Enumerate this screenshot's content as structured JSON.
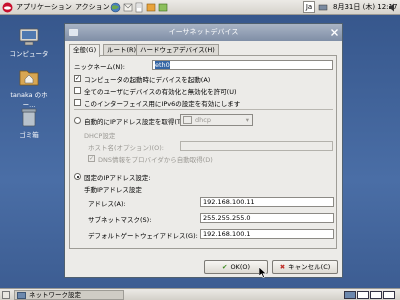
{
  "top_panel": {
    "apps_menu": "アプリケーション",
    "actions_menu": "アクション",
    "ime_indicator": "Ja",
    "clock": "8月31日 (木) 12:17"
  },
  "desktop_icons": [
    {
      "label": "コンピュータ"
    },
    {
      "label": "tanaka のホー..."
    },
    {
      "label": "ゴミ箱"
    }
  ],
  "window": {
    "title": "イーサネットデバイス",
    "tabs": [
      "全般(G)",
      "ルート(R)",
      "ハードウェアデバイス(H)"
    ],
    "nickname_label": "ニックネーム(N):",
    "nickname_value": "eth0",
    "options": [
      {
        "label": "コンピュータの起動時にデバイスを起動(A)",
        "checked": true
      },
      {
        "label": "全てのユーザにデバイスの有効化と無効化を許可(U)",
        "checked": false
      },
      {
        "label": "このインターフェイス用にIPv6の設定を有効にします",
        "checked": false
      }
    ],
    "auto_ip_label": "自動的にIPアドレス設定を取得(T):",
    "auto_ip_method": "dhcp",
    "dhcp_header": "DHCP設定",
    "hostname_label": "ホスト名(オプション)(O):",
    "dns_label": "DNS情報をプロバイダから自動取得(D)",
    "static_ip_label": "固定のIPアドレス設定:",
    "manual_header": "手動IPアドレス設定",
    "address_label": "アドレス(A):",
    "address_value": "192.168.100.11",
    "netmask_label": "サブネットマスク(S):",
    "netmask_value": "255.255.255.0",
    "gateway_label": "デフォルトゲートウェイアドレス(G):",
    "gateway_value": "192.168.100.1",
    "ok_label": "OK(O)",
    "cancel_label": "キャンセル(C)"
  },
  "taskbar": {
    "item_label": "ネットワーク設定"
  },
  "colors": {
    "desktop": "#3d5f94",
    "titlebar": "#8a98ae",
    "selection": "#3465a4"
  }
}
